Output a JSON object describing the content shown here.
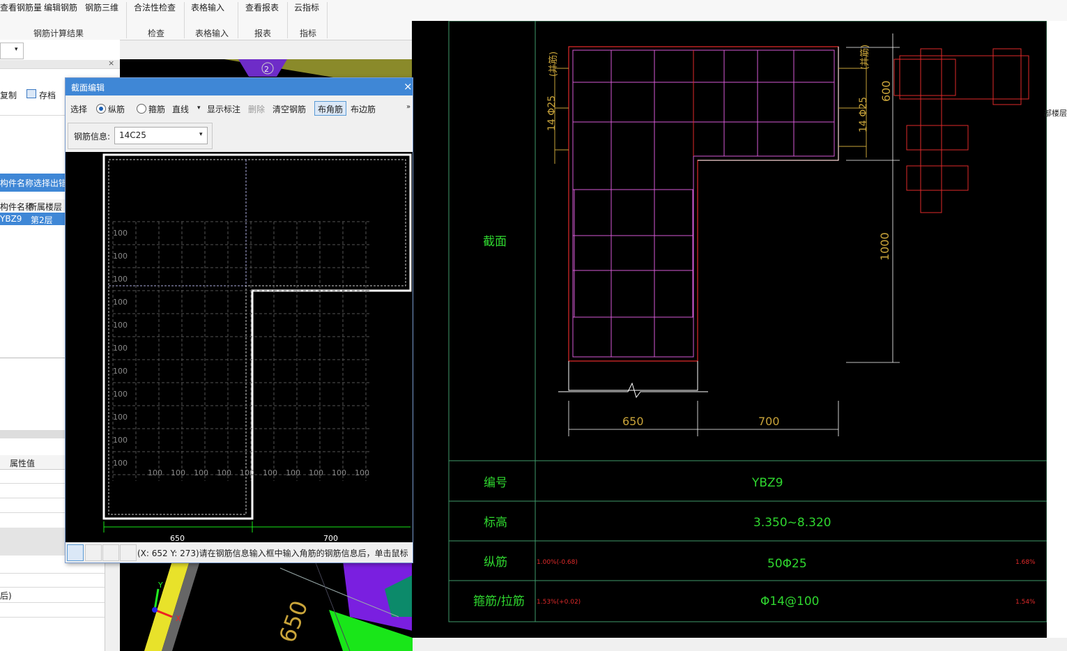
{
  "ribbon": {
    "buttons": [
      "查看钢筋量",
      "编辑钢筋",
      "钢筋三维",
      "合法性检查",
      "表格输入",
      "查看报表",
      "云指标"
    ],
    "groups": [
      "钢筋计算结果",
      "检查",
      "表格输入",
      "报表",
      "指标"
    ]
  },
  "left_panel": {
    "copy_label": "复制",
    "save_label": "存档",
    "close_symbol": "×",
    "error_banner": "构件名称选择出错",
    "col_headers": [
      "构件名称",
      "所属楼层"
    ],
    "row": [
      "YBZ9",
      "第2层"
    ],
    "attr_header": "属性值",
    "lower_text": "后)"
  },
  "dialog": {
    "title": "截面编辑",
    "close_symbol": "×",
    "toolbar": {
      "select": "选择",
      "radio_longitudinal": "纵筋",
      "radio_stirrup": "箍筋",
      "line_type": "直线",
      "show_annotation": "显示标注",
      "delete": "删除",
      "clear": "清空钢筋",
      "corner_bar": "布角筋",
      "edge_bar": "布边筋",
      "more": "»"
    },
    "rebar_info_label": "钢筋信息:",
    "rebar_info_value": "14C25",
    "grid_label": "100",
    "dim_left": "650",
    "dim_right": "700",
    "status_text": "(X: 652 Y: 273)请在钢筋信息输入框中输入角筋的钢筋信息后，单击鼠标"
  },
  "view3d": {
    "label_650": "650",
    "axis_x": "X",
    "axis_y": "Y",
    "axis_number": "2"
  },
  "cad": {
    "section_label": "截面",
    "dim_600": "600",
    "dim_1000": "1000",
    "dim_650": "650",
    "dim_700": "700",
    "bar_label_left": "14 Φ25",
    "bar_label_right": "14 Φ25",
    "bracket_left": "(并筋)",
    "bracket_right": "(并筋)",
    "table": {
      "rows": [
        {
          "label": "编号",
          "value": "YBZ9",
          "left_note": "",
          "right_note": ""
        },
        {
          "label": "标高",
          "value": "3.350~8.320",
          "left_note": "",
          "right_note": ""
        },
        {
          "label": "纵筋",
          "value": "50Φ25",
          "left_note": "1.00%(-0.68)",
          "right_note": "1.68%"
        },
        {
          "label": "箍筋/拉筋",
          "value": "Φ14@100",
          "left_note": "1.53%(+0.02)",
          "right_note": "1.54%"
        }
      ]
    },
    "right_edge_text": "部楼层"
  },
  "colors": {
    "ribbon_bg": "#f7f7f7",
    "dialog_title": "#3f87d6",
    "cad_bg": "#000000",
    "cad_frame": "#3f9a6a",
    "stirrup": "#d65ad6",
    "bar_red": "#e02a2a",
    "text_green": "#2fd62f",
    "dim_yellow": "#c9a43a"
  }
}
